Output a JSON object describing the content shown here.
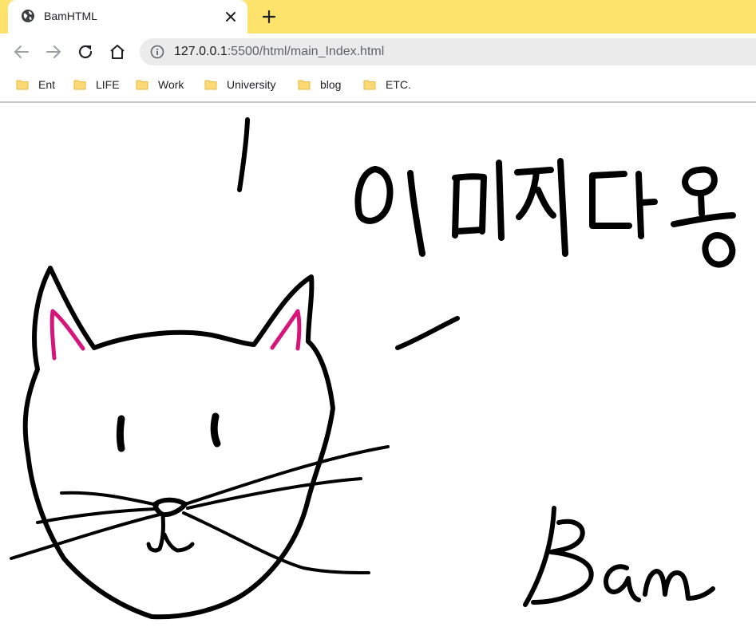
{
  "browser": {
    "tab": {
      "title": "BamHTML",
      "icon": "globe-icon"
    },
    "new_tab_icon": "plus-icon",
    "toolbar": {
      "back_icon": "arrow-left-icon",
      "forward_icon": "arrow-right-icon",
      "reload_icon": "reload-icon",
      "home_icon": "home-icon",
      "info_icon": "info-icon",
      "url_host": "127.0.0.1",
      "url_rest": ":5500/html/main_Index.html"
    },
    "bookmarks": [
      {
        "label": "Ent"
      },
      {
        "label": "LIFE"
      },
      {
        "label": "Work"
      },
      {
        "label": "University"
      },
      {
        "label": "blog"
      },
      {
        "label": "ETC."
      }
    ],
    "colors": {
      "tabstrip": "#fde26b",
      "folder": "#fbd977",
      "ink": "#000000",
      "ear_pink": "#d6157a"
    }
  },
  "page": {
    "drawing": {
      "speech_text": "이미지다옹",
      "signature": "Bam"
    }
  }
}
